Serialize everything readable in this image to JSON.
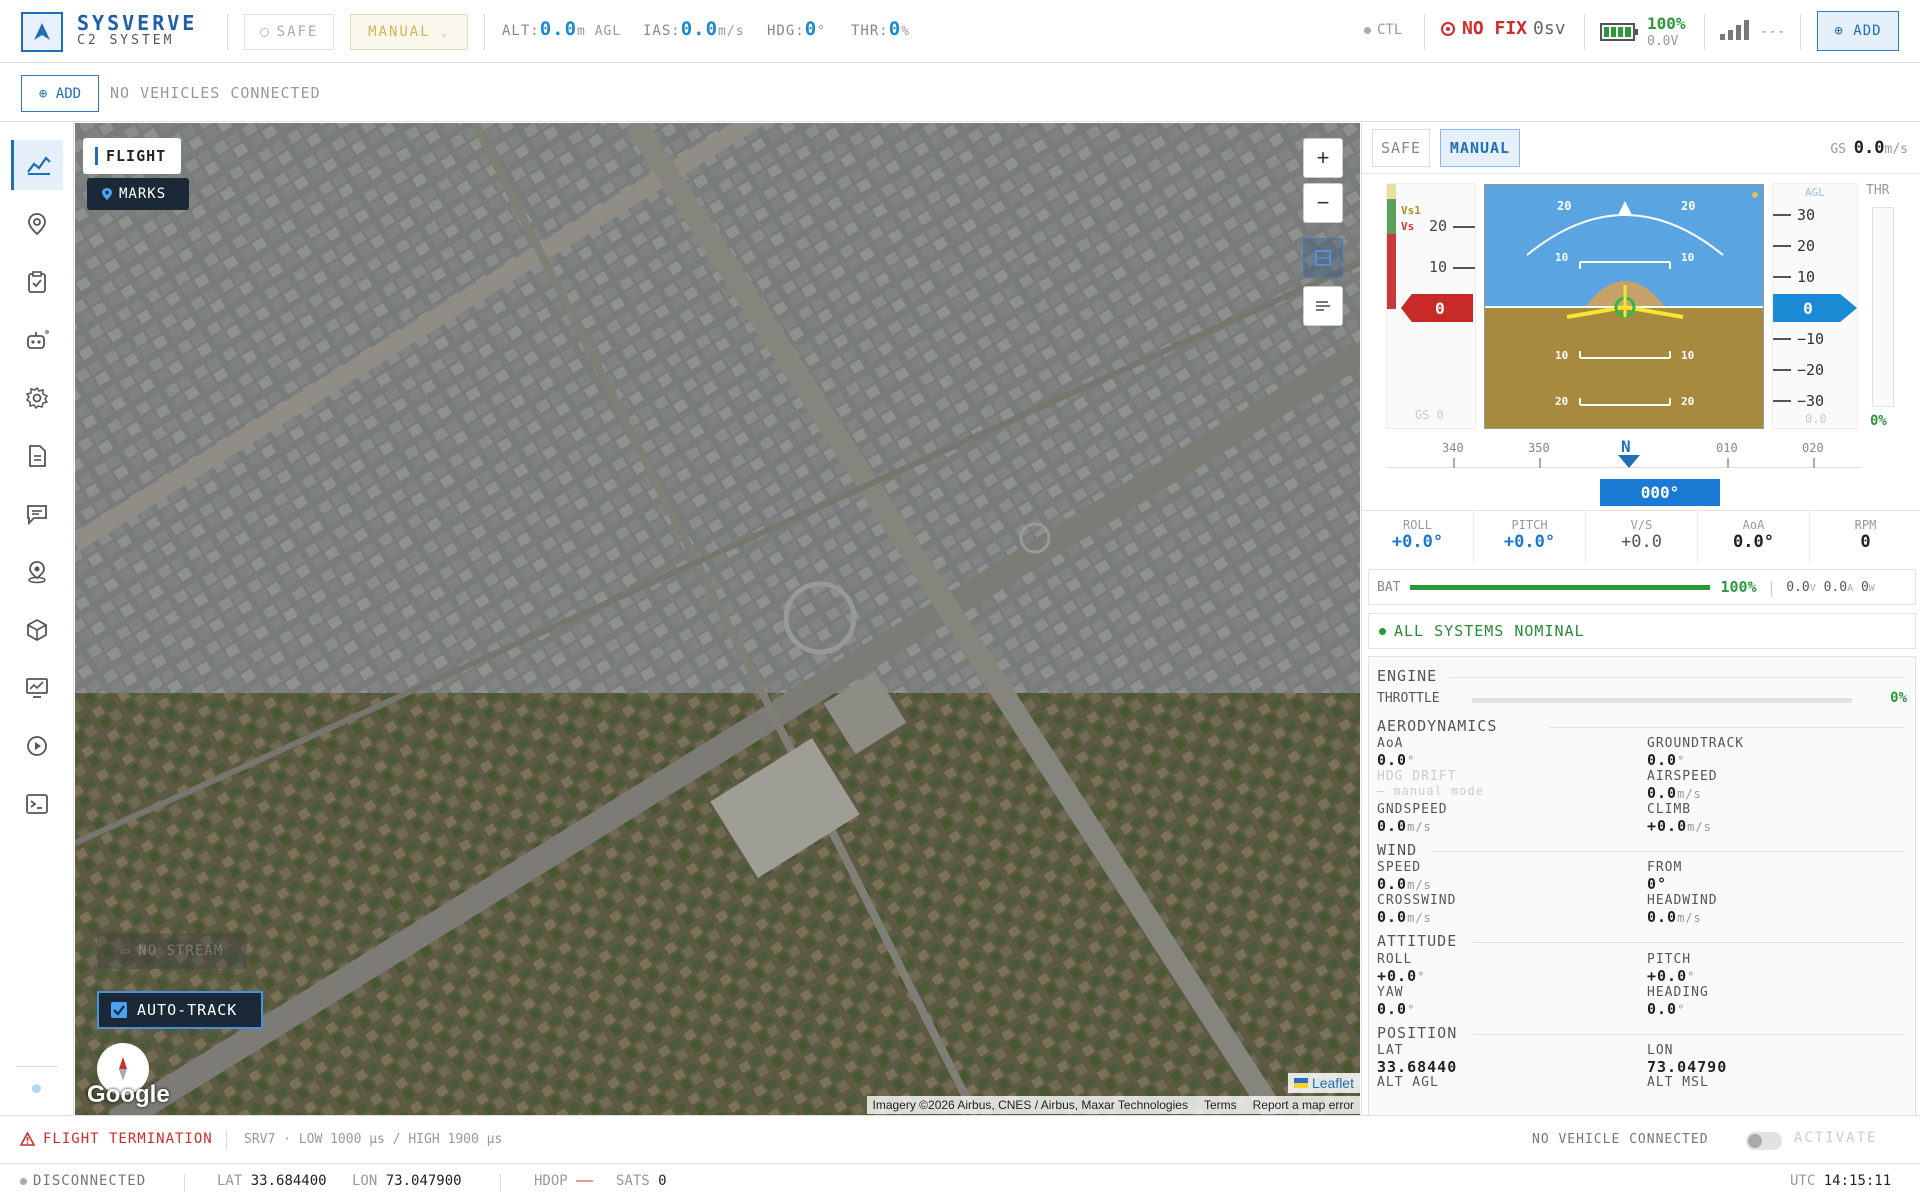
{
  "brand": {
    "title": "SYSVERVE",
    "subtitle": "C2 SYSTEM"
  },
  "topbar": {
    "safe_label": "SAFE",
    "mode_label": "MANUAL",
    "alt": {
      "label": "ALT:",
      "value": "0.0",
      "unit": "m AGL"
    },
    "ias": {
      "label": "IAS:",
      "value": "0.0",
      "unit": "m/s"
    },
    "hdg": {
      "label": "HDG:",
      "value": "0",
      "unit": "°"
    },
    "thr": {
      "label": "THR:",
      "value": "0",
      "unit": "%"
    },
    "ctl": "CTL",
    "gps": "NO FIX",
    "sats": "0sv",
    "battery_pct": "100%",
    "battery_volt": "0.0V",
    "signal_text": "---",
    "add_label": "⊕ ADD"
  },
  "vehicle_bar": {
    "add_label": "⊕ ADD",
    "status": "NO VEHICLES CONNECTED"
  },
  "sidebar": {
    "items": [
      "flight",
      "map-pin",
      "checklist",
      "robot",
      "settings",
      "logs",
      "messages",
      "geofence",
      "3d",
      "monitor",
      "replay",
      "terminal"
    ]
  },
  "map": {
    "tab_flight": "FLIGHT",
    "tab_marks": "MARKS",
    "zoom_in": "+",
    "zoom_out": "−",
    "no_stream": "NO STREAM",
    "auto_track": "AUTO-TRACK",
    "google": "Google",
    "leaflet": "Leaflet",
    "attribution": "Imagery ©2026 Airbus, CNES / Airbus, Maxar Technologies",
    "terms": "Terms",
    "report": "Report a map error"
  },
  "panel": {
    "mode_safe": "SAFE",
    "mode_manual": "MANUAL",
    "gs_label": "GS",
    "gs_value": "0.0",
    "gs_unit": "m/s",
    "speed_tape": {
      "ticks": [
        "20",
        "10"
      ],
      "vs1": "Vs1",
      "vs": "Vs",
      "value": "0",
      "gs": "GS 0"
    },
    "alt_tape": {
      "agl": "AGL",
      "ticks": [
        "30",
        "20",
        "10",
        "−10",
        "−20",
        "−30"
      ],
      "value": "0",
      "bottom": "0.0"
    },
    "thr_label": "THR",
    "thr_pct": "0%",
    "pitch_labels": [
      "20",
      "10",
      "10",
      "20"
    ],
    "heading": {
      "ticks": [
        "340",
        "350",
        "N",
        "010",
        "020"
      ],
      "value": "000°"
    },
    "stats": [
      {
        "label": "ROLL",
        "value": "+0.0°"
      },
      {
        "label": "PITCH",
        "value": "+0.0°"
      },
      {
        "label": "V/S",
        "value": "+0.0"
      },
      {
        "label": "AoA",
        "value": "0.0°"
      },
      {
        "label": "RPM",
        "value": "0"
      }
    ],
    "bat": {
      "label": "BAT",
      "pct": "100%",
      "level": 1.0,
      "volt": "0.0",
      "volt_u": "V",
      "amp": "0.0",
      "amp_u": "A",
      "watt": "0",
      "watt_u": "W"
    },
    "status": "ALL SYSTEMS NOMINAL",
    "engine": {
      "title": "ENGINE",
      "throttle": "THROTTLE",
      "throttle_pct": "0%"
    },
    "aero": {
      "title": "AERODYNAMICS",
      "aoa_l": "AoA",
      "aoa_v": "0.0",
      "aoa_u": "°",
      "gt_l": "GROUNDTRACK",
      "gt_v": "0.0",
      "gt_u": "°",
      "hdg_l": "HDG DRIFT",
      "hdg_v": "— manual mode",
      "as_l": "AIRSPEED",
      "as_v": "0.0",
      "as_u": "m/s",
      "gs_l": "GNDSPEED",
      "gs_v": "0.0",
      "gs_u": "m/s",
      "cl_l": "CLIMB",
      "cl_v": "+0.0",
      "cl_u": "m/s"
    },
    "wind": {
      "title": "WIND",
      "sp_l": "SPEED",
      "sp_v": "0.0",
      "sp_u": "m/s",
      "fr_l": "FROM",
      "fr_v": "0°",
      "cw_l": "CROSSWIND",
      "cw_v": "0.0",
      "cw_u": "m/s",
      "hw_l": "HEADWIND",
      "hw_v": "0.0",
      "hw_u": "m/s"
    },
    "attitude": {
      "title": "ATTITUDE",
      "r_l": "ROLL",
      "r_v": "+0.0",
      "r_u": "°",
      "p_l": "PITCH",
      "p_v": "+0.0",
      "p_u": "°",
      "y_l": "YAW",
      "y_v": "0.0",
      "y_u": "°",
      "h_l": "HEADING",
      "h_v": "0.0",
      "h_u": "°"
    },
    "position": {
      "title": "POSITION",
      "lat_l": "LAT",
      "lat_v": "33.68440",
      "lon_l": "LON",
      "lon_v": "73.04790",
      "agl_l": "ALT AGL",
      "msl_l": "ALT MSL"
    }
  },
  "bottom": {
    "ft_label": "FLIGHT TERMINATION",
    "srv": "SRV7 · LOW 1000 µs / HIGH 1900 µs",
    "nvc": "NO VEHICLE CONNECTED",
    "activate": "ACTIVATE",
    "conn": "DISCONNECTED",
    "lat_l": "LAT",
    "lat_v": "33.684400",
    "lon_l": "LON",
    "lon_v": "73.047900",
    "hdop_l": "HDOP",
    "hdop_v": "——",
    "sats_l": "SATS",
    "sats_v": "0",
    "utc_l": "UTC",
    "utc_v": "14:15:11"
  },
  "colors": {
    "accent": "#1f6fb8",
    "danger": "#d12a2a",
    "ok": "#2a9a3a",
    "manual": "#d3b55a"
  }
}
